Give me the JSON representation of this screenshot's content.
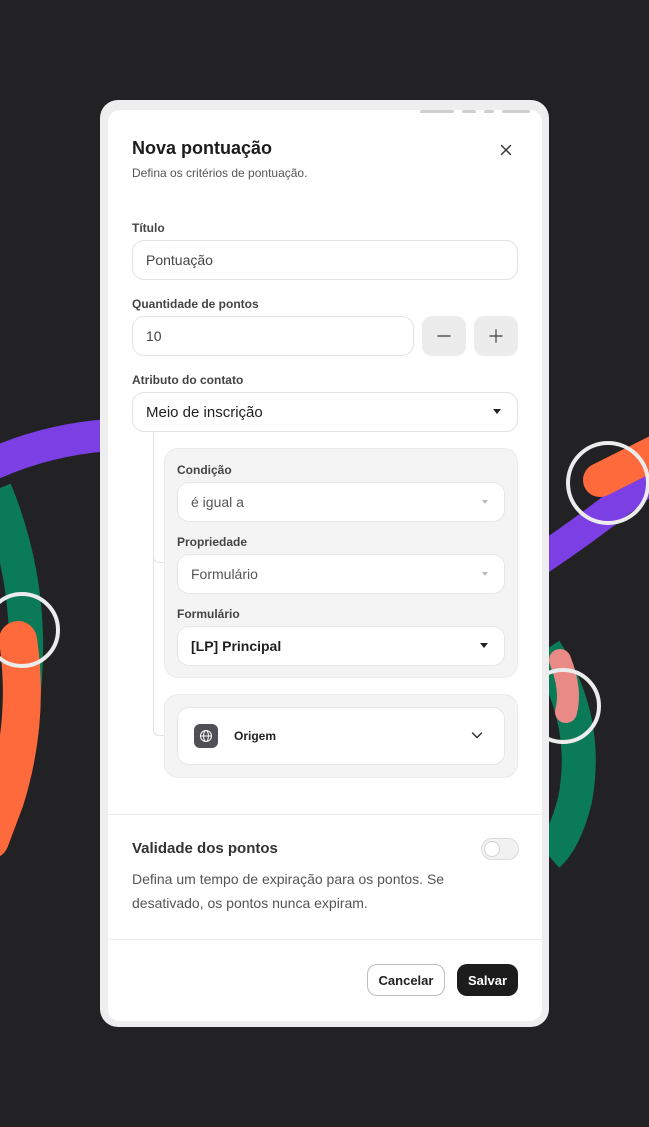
{
  "modal": {
    "title": "Nova pontuação",
    "subtitle": "Defina os critérios de pontuação."
  },
  "form": {
    "title_label": "Título",
    "title_value": "Pontuação",
    "points_label": "Quantidade de pontos",
    "points_value": "10",
    "attribute_label": "Atributo do contato",
    "attribute_value": "Meio de inscrição"
  },
  "condition_card": {
    "condition_label": "Condição",
    "condition_value": "é igual a",
    "property_label": "Propriedade",
    "property_value": "Formulário",
    "form_label": "Formulário",
    "form_value": "[LP] Principal"
  },
  "origin": {
    "label": "Origem",
    "icon": "globe-icon"
  },
  "validity": {
    "title": "Validade dos pontos",
    "description": "Defina um tempo de expiração para os pontos. Se desativado, os pontos nunca expiram.",
    "enabled": false
  },
  "footer": {
    "cancel_label": "Cancelar",
    "save_label": "Salvar"
  },
  "colors": {
    "background": "#222224",
    "primary_button": "#1c1c1c",
    "card_bg": "#f4f4f4",
    "deco_purple": "#7b3fe4",
    "deco_orange": "#ff6a3d",
    "deco_green": "#0b7a57",
    "deco_pink": "#e98a86"
  }
}
